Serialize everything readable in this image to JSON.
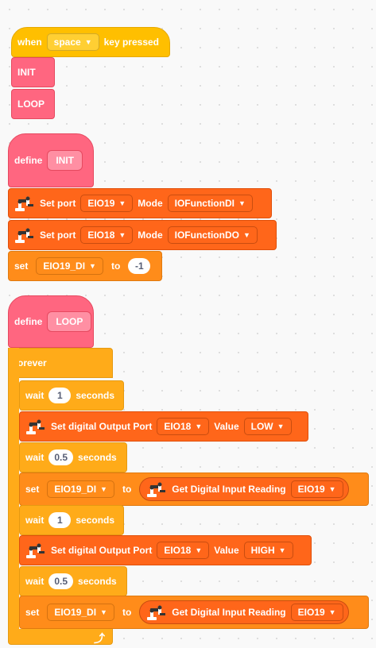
{
  "event": {
    "when": "when",
    "key": "space",
    "suffix": "key pressed"
  },
  "calls": {
    "init": "INIT",
    "loop": "LOOP"
  },
  "define_init": {
    "define": "define",
    "name": "INIT"
  },
  "setport1": {
    "label": "Set port",
    "port": "EIO19",
    "mode_label": "Mode",
    "mode": "IOFunctionDI"
  },
  "setport2": {
    "label": "Set port",
    "port": "EIO18",
    "mode_label": "Mode",
    "mode": "IOFunctionDO"
  },
  "setvar1": {
    "set": "set",
    "var": "EIO19_DI",
    "to": "to",
    "value": "-1"
  },
  "define_loop": {
    "define": "define",
    "name": "LOOP"
  },
  "forever": {
    "label": "forever"
  },
  "wait1": {
    "wait": "wait",
    "value": "1",
    "unit": "seconds"
  },
  "out1": {
    "label": "Set digital Output Port",
    "port": "EIO18",
    "value_label": "Value",
    "value": "LOW"
  },
  "wait2": {
    "wait": "wait",
    "value": "0.5",
    "unit": "seconds"
  },
  "read1": {
    "set": "set",
    "var": "EIO19_DI",
    "to": "to",
    "reporter": "Get Digital Input Reading",
    "port": "EIO19"
  },
  "wait3": {
    "wait": "wait",
    "value": "1",
    "unit": "seconds"
  },
  "out2": {
    "label": "Set digital Output Port",
    "port": "EIO18",
    "value_label": "Value",
    "value": "HIGH"
  },
  "wait4": {
    "wait": "wait",
    "value": "0.5",
    "unit": "seconds"
  },
  "read2": {
    "set": "set",
    "var": "EIO19_DI",
    "to": "to",
    "reporter": "Get Digital Input Reading",
    "port": "EIO19"
  },
  "icons": {
    "robot": "robot-arm-icon",
    "dropdown": "caret-down-icon",
    "loop": "loop-arrow-icon"
  },
  "colors": {
    "event": "#ffbf00",
    "define": "#ff6680",
    "extension": "#ff661a",
    "variables": "#ff8c1a",
    "control": "#ffab19"
  }
}
